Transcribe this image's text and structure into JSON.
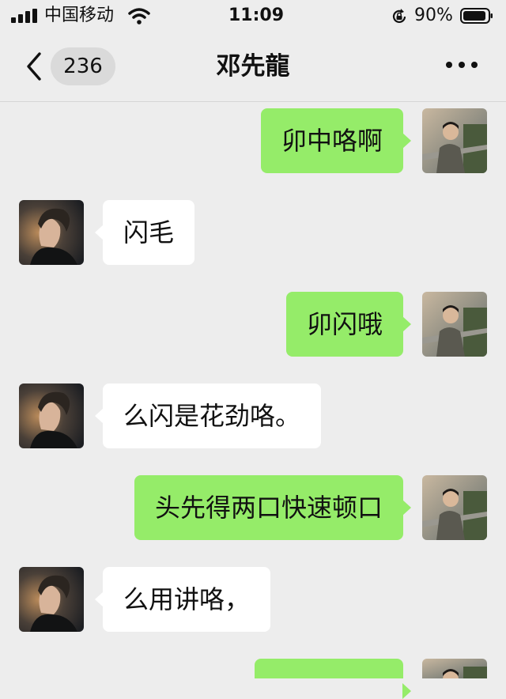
{
  "status_bar": {
    "carrier": "中国移动",
    "time": "11:09",
    "battery": "90%",
    "icons": [
      "signal-icon",
      "wifi-icon",
      "rotation-lock-icon",
      "battery-icon"
    ]
  },
  "nav": {
    "unread_count": "236",
    "title": "邓先龍",
    "icons": [
      "chevron-left-icon",
      "more-icon"
    ]
  },
  "colors": {
    "background": "#ededed",
    "incoming_bubble": "#ffffff",
    "outgoing_bubble": "#95ec69"
  },
  "messages": [
    {
      "from": "me",
      "text": "卯中咯啊"
    },
    {
      "from": "other",
      "text": "闪毛"
    },
    {
      "from": "me",
      "text": "卯闪哦"
    },
    {
      "from": "other",
      "text": "么闪是花劲咯。"
    },
    {
      "from": "me",
      "text": "头先得两口快速顿口"
    },
    {
      "from": "other",
      "text": "么用讲咯，"
    },
    {
      "from": "me",
      "text": ""
    }
  ]
}
